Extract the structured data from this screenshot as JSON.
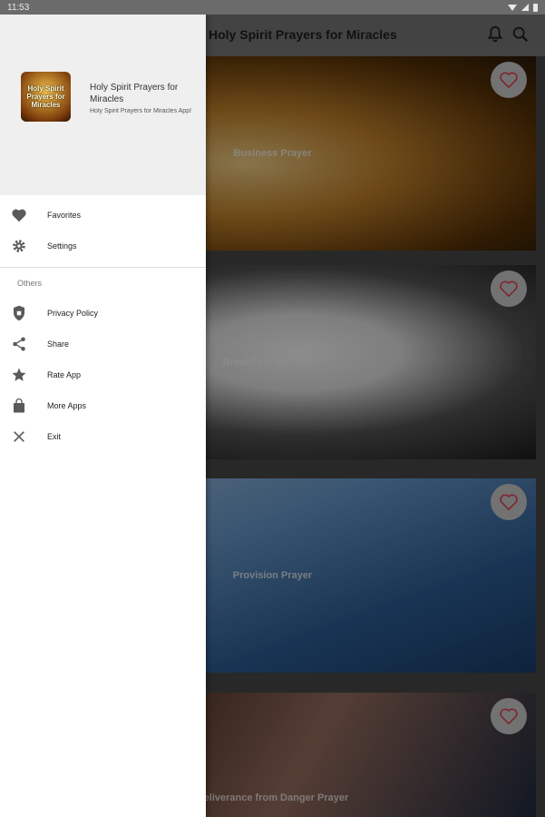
{
  "status_bar": {
    "time": "11:53"
  },
  "app_bar": {
    "title": "Holy Spirit Prayers for Miracles"
  },
  "drawer": {
    "app_name": "Holy Spirit Prayers for Miracles",
    "app_subtitle": "Holy Spirit Prayers for Miracles App!",
    "app_icon_text": [
      "Holy Spirit",
      "Prayers for",
      "Miracles"
    ],
    "items": [
      {
        "label": "Favorites",
        "icon": "heart-icon"
      },
      {
        "label": "Settings",
        "icon": "gear-icon"
      }
    ],
    "section_title": "Others",
    "other_items": [
      {
        "label": "Privacy Policy",
        "icon": "shield-icon"
      },
      {
        "label": "Share",
        "icon": "share-icon"
      },
      {
        "label": "Rate App",
        "icon": "star-icon"
      },
      {
        "label": "More Apps",
        "icon": "shopping-bag-icon"
      },
      {
        "label": "Exit",
        "icon": "close-icon"
      }
    ]
  },
  "prayers": [
    {
      "title": "Business Prayer"
    },
    {
      "title": "Breakthrough Prayer"
    },
    {
      "title": "Provision Prayer"
    },
    {
      "title": "Deliverance from Danger Prayer"
    }
  ],
  "colors": {
    "heart": "#e8445a",
    "drawer_bg": "#ffffff",
    "header_bg": "#efefef"
  }
}
